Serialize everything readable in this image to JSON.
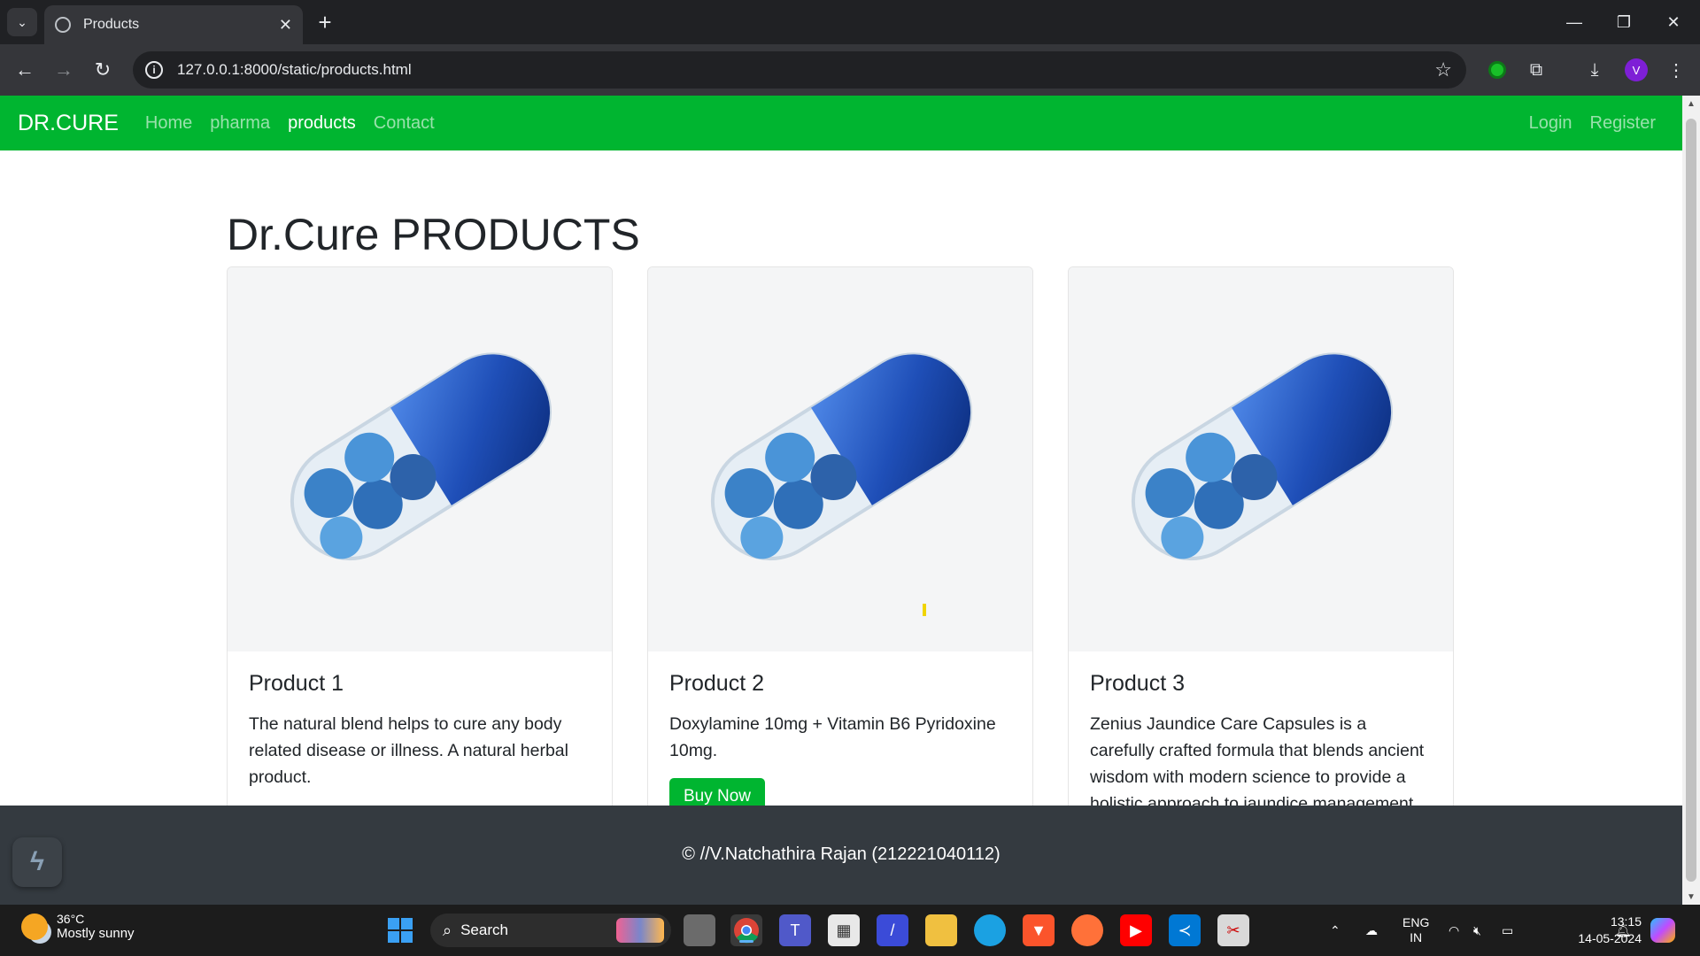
{
  "browser": {
    "tab_title": "Products",
    "url": "127.0.0.1:8000/static/products.html",
    "profile_initial": "V"
  },
  "site": {
    "brand": "DR.CURE",
    "nav": [
      "Home",
      "pharma",
      "products",
      "Contact"
    ],
    "nav_right": [
      "Login",
      "Register"
    ],
    "heading": "Dr.Cure PRODUCTS",
    "products": [
      {
        "title": "Product 1",
        "text": "The natural blend helps to cure any body related disease or illness. A natural herbal product."
      },
      {
        "title": "Product 2",
        "text": "Doxylamine 10mg + Vitamin B6 Pyridoxine 10mg.",
        "button": "Buy Now"
      },
      {
        "title": "Product 3",
        "text": "Zenius Jaundice Care Capsules is a carefully crafted formula that blends ancient wisdom with modern science to provide a holistic approach to jaundice management."
      }
    ],
    "footer": "© //V.Natchathira Rajan (212221040112)"
  },
  "taskbar": {
    "temperature": "36°C",
    "weather": "Mostly sunny",
    "search_label": "Search",
    "lang": "ENG",
    "region": "IN",
    "time": "13:15",
    "date": "14-05-2024"
  },
  "colors": {
    "brand_green": "#00b530",
    "footer_bg": "#343a40",
    "capsule_blue": "#1f4fb8"
  }
}
